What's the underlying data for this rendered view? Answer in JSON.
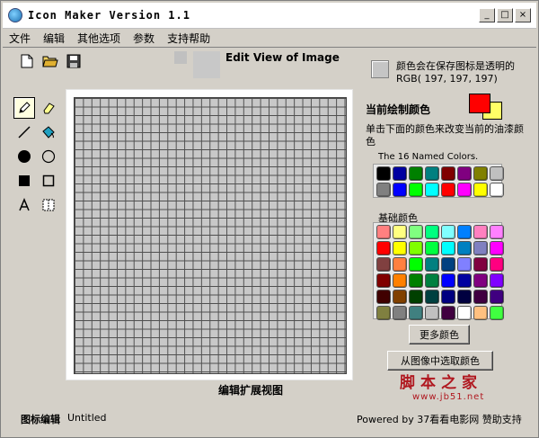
{
  "window": {
    "title": "Icon Maker Version 1.1",
    "minimize": "_",
    "maximize": "□",
    "close": "×"
  },
  "menu": [
    "文件",
    "编辑",
    "其他选项",
    "参数",
    "支持帮助"
  ],
  "edit_view": {
    "title": "Edit View of Image",
    "expand_label": "编辑扩展视图"
  },
  "transparent": {
    "text": "颜色会在保存图标是透明的 RGB( 197, 197, 197)",
    "color": "#c5c5c5"
  },
  "current": {
    "label": "当前绘制颜色",
    "foreground": "#ff0000",
    "background": "#ffff66"
  },
  "change_text": "单击下面的颜色来改变当前的油漆颜色",
  "named": {
    "label": "The 16 Named Colors.",
    "colors": [
      "#000000",
      "#0000a0",
      "#008000",
      "#008080",
      "#800000",
      "#800080",
      "#808000",
      "#c0c0c0",
      "#808080",
      "#0000ff",
      "#00ff00",
      "#00ffff",
      "#ff0000",
      "#ff00ff",
      "#ffff00",
      "#ffffff"
    ]
  },
  "basic": {
    "label": "基础颜色",
    "colors": [
      "#ff8080",
      "#ffff80",
      "#80ff80",
      "#00ff80",
      "#80ffff",
      "#0080ff",
      "#ff80c0",
      "#ff80ff",
      "#ff0000",
      "#ffff00",
      "#80ff00",
      "#00ff40",
      "#00ffff",
      "#0080c0",
      "#8080c0",
      "#ff00ff",
      "#804040",
      "#ff8040",
      "#00ff00",
      "#008080",
      "#004080",
      "#8080ff",
      "#800040",
      "#ff0080",
      "#800000",
      "#ff8000",
      "#008000",
      "#008040",
      "#0000ff",
      "#0000a0",
      "#800080",
      "#8000ff",
      "#400000",
      "#804000",
      "#004000",
      "#004040",
      "#000080",
      "#000040",
      "#400040",
      "#400080",
      "#808040",
      "#808080",
      "#408080",
      "#c0c0c0",
      "#400040",
      "#ffffff",
      "#ffc080",
      "#40ff40"
    ]
  },
  "buttons": {
    "more": "更多颜色",
    "pick": "从图像中选取颜色"
  },
  "status": {
    "label": "图标编辑",
    "value": "Untitled",
    "powered": "Powered by 37看看电影网 赞助支持"
  },
  "watermark": {
    "top": "脚本之家",
    "bottom": "www.jb51.net"
  }
}
